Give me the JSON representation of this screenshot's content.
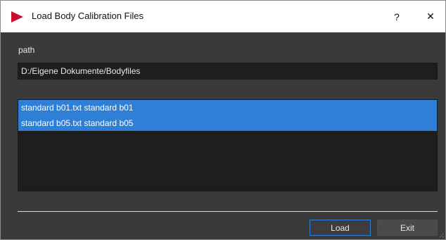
{
  "window": {
    "title": "Load Body Calibration Files",
    "help_label": "?",
    "close_label": "✕"
  },
  "path": {
    "label": "path",
    "value": "D:/Eigene Dokumente/Bodyfiles"
  },
  "files": [
    {
      "filename": "standard b01.txt",
      "calibration": "standard b01",
      "selected": true
    },
    {
      "filename": "standard b05.txt",
      "calibration": "standard b05",
      "selected": true
    }
  ],
  "buttons": {
    "load_label": "Load",
    "exit_label": "Exit"
  },
  "colors": {
    "selection": "#2f7fd6",
    "app_icon": "#c8102e"
  }
}
